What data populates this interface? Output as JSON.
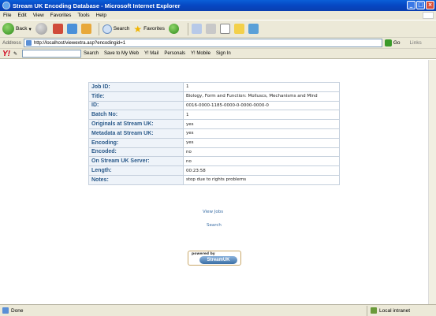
{
  "window": {
    "title": "Stream UK Encoding Database - Microsoft Internet Explorer",
    "minimize": "_",
    "maximize": "□",
    "close": "×"
  },
  "menu": [
    "File",
    "Edit",
    "View",
    "Favorites",
    "Tools",
    "Help"
  ],
  "toolbar": {
    "back": "Back",
    "search": "Search",
    "favorites": "Favorites"
  },
  "address": {
    "label": "Address",
    "url": "http://localhost/viewextra.asp?encodingid=1",
    "go": "Go",
    "links": "Links"
  },
  "yahoo": {
    "logo": "Y!",
    "search": "Search",
    "save": "Save to My Web",
    "mail": "Y! Mail",
    "personals": "Personals",
    "mobile": "Y! Mobile",
    "signin": "Sign In"
  },
  "details": [
    {
      "label": "Job ID:",
      "value": "1"
    },
    {
      "label": "Title:",
      "value": "Biology, Form and Function: Molluscs, Mechanisms and Mind"
    },
    {
      "label": "ID:",
      "value": "0016-0000-1185-0000-0-0000-0000-0"
    },
    {
      "label": "Batch No:",
      "value": "1"
    },
    {
      "label": "Originals at Stream UK:",
      "value": "yes"
    },
    {
      "label": "Metadata at Stream UK:",
      "value": "yes"
    },
    {
      "label": "Encoding:",
      "value": "yes"
    },
    {
      "label": "Encoded:",
      "value": "no"
    },
    {
      "label": "On Stream UK Server:",
      "value": "no"
    },
    {
      "label": "Length:",
      "value": "00:23:58"
    },
    {
      "label": "Notes:",
      "value": "stop due to rights problems"
    }
  ],
  "links": {
    "view_jobs": "View Jobs",
    "search": "Search"
  },
  "powered_by": {
    "line1": "powered by",
    "brand": "StreamUK"
  },
  "status": {
    "text": "Done",
    "zone": "Local intranet"
  }
}
